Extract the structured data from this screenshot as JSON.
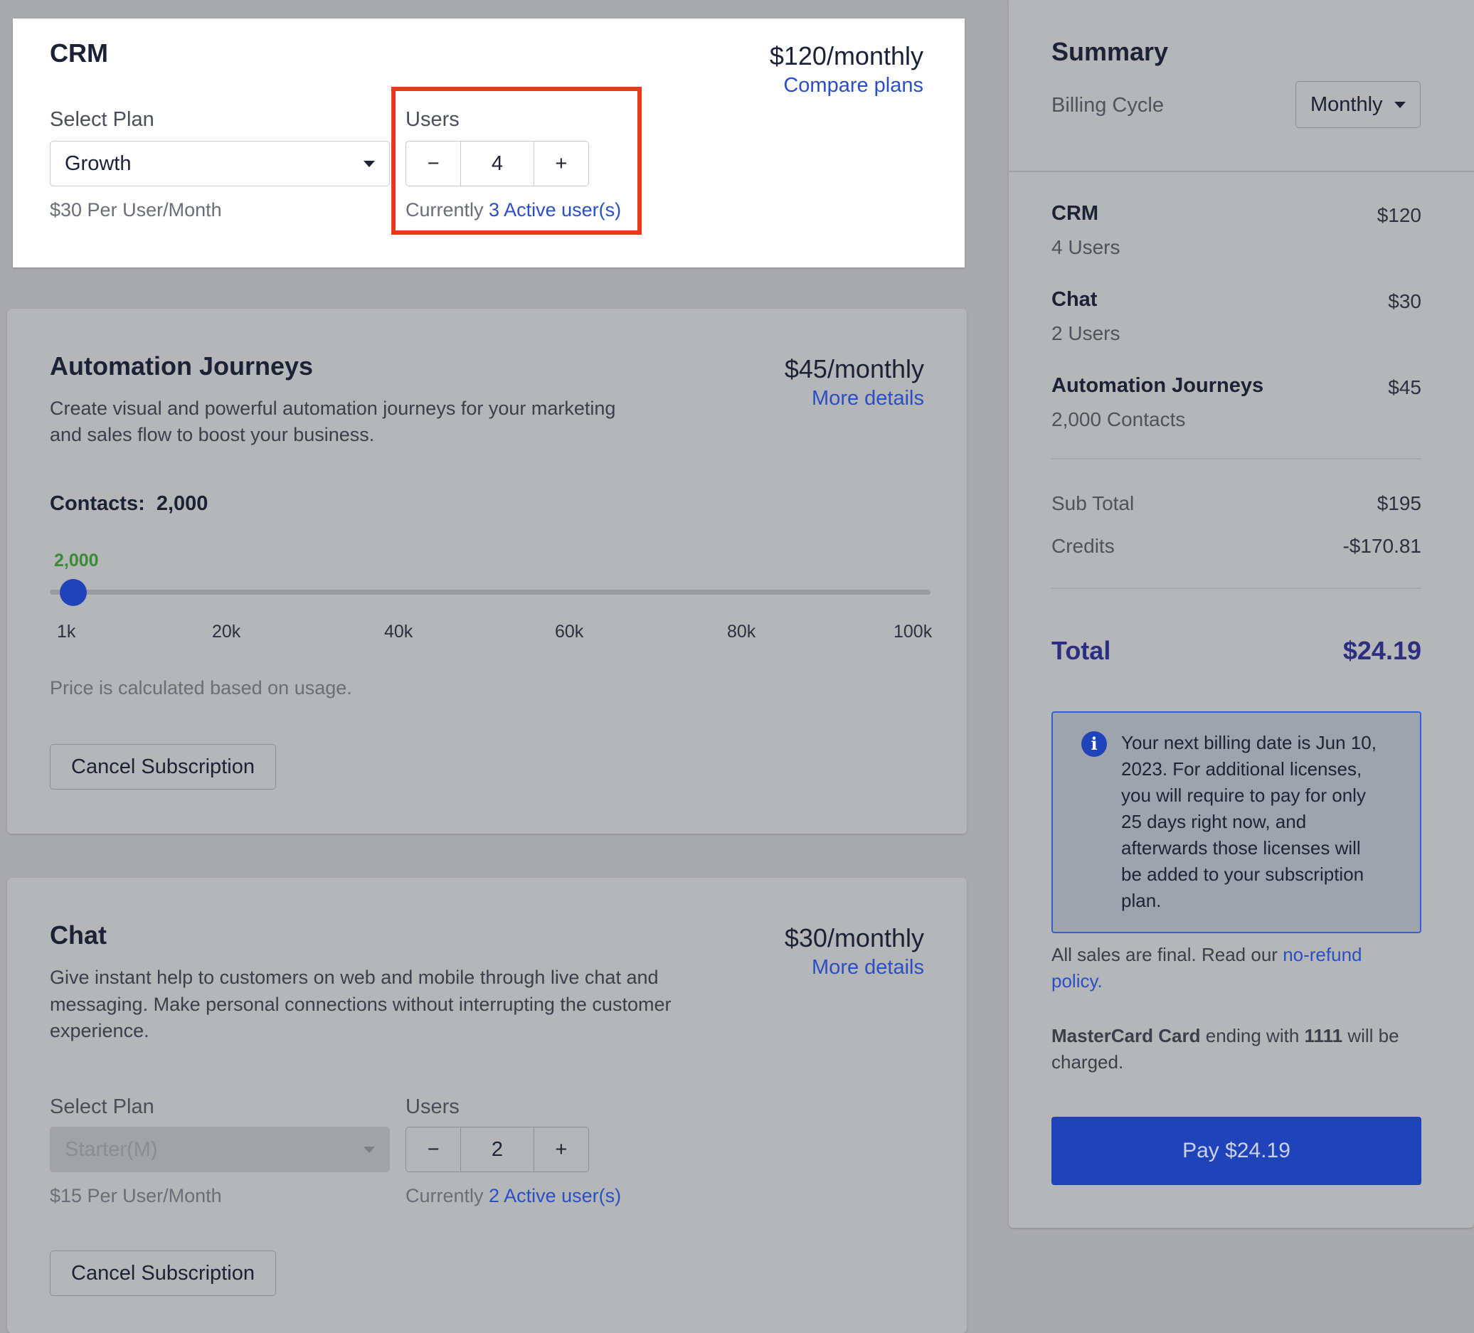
{
  "crm": {
    "title": "CRM",
    "price": "$120/monthly",
    "compare_link": "Compare plans",
    "select_plan_label": "Select Plan",
    "plan_value": "Growth",
    "plan_note": "$30 Per User/Month",
    "users_label": "Users",
    "users_value": "4",
    "minus": "−",
    "plus": "+",
    "currently_prefix": "Currently",
    "active_users_link": "3 Active user(s)"
  },
  "automation": {
    "title": "Automation Journeys",
    "price": "$45/monthly",
    "details_link": "More details",
    "description_line1": "Create visual and powerful automation journeys for your marketing",
    "description_line2": "and sales flow to boost your business.",
    "contacts_label": "Contacts:",
    "contacts_value": "2,000",
    "slider_value_label": "2,000",
    "slider": {
      "min": 1000,
      "max": 100000,
      "value": 2000
    },
    "ticks": [
      "1k",
      "20k",
      "40k",
      "60k",
      "80k",
      "100k"
    ],
    "price_note": "Price is calculated based on usage.",
    "cancel_button": "Cancel Subscription",
    "accent_color": "#3a8a3a"
  },
  "chat": {
    "title": "Chat",
    "price": "$30/monthly",
    "details_link": "More details",
    "description_line1": "Give instant help to customers on web and mobile through live chat and",
    "description_line2": "messaging. Make personal connections without interrupting the customer",
    "description_line3": "experience.",
    "select_plan_label": "Select Plan",
    "plan_value": "Starter(M)",
    "plan_note": "$15 Per User/Month",
    "users_label": "Users",
    "users_value": "2",
    "minus": "−",
    "plus": "+",
    "currently_prefix": "Currently",
    "active_users_link": "2 Active user(s)",
    "cancel_button": "Cancel Subscription"
  },
  "summary": {
    "title": "Summary",
    "billing_cycle_label": "Billing Cycle",
    "billing_cycle_value": "Monthly",
    "items": [
      {
        "name": "CRM",
        "detail": "4 Users",
        "amount": "$120"
      },
      {
        "name": "Chat",
        "detail": "2 Users",
        "amount": "$30"
      },
      {
        "name": "Automation Journeys",
        "detail": "2,000 Contacts",
        "amount": "$45"
      }
    ],
    "subtotal_label": "Sub Total",
    "subtotal_value": "$195",
    "credits_label": "Credits",
    "credits_value": "-$170.81",
    "total_label": "Total",
    "total_value": "$24.19",
    "info_icon": "info-icon",
    "info_lines": [
      "Your next billing date is Jun 10,",
      "2023. For additional licenses,",
      "you will require to pay for only",
      "25 days right now, and",
      "afterwards those licenses will",
      "be added to your subscription",
      "plan."
    ],
    "final_prefix": "All sales are final. Read our",
    "refund_link_1": "no-refund",
    "refund_link_2": "policy.",
    "card_brand": "MasterCard Card",
    "card_mid": "ending with",
    "card_last4": "1111",
    "card_suffix": "will be",
    "card_suffix_2": "charged.",
    "pay_button": "Pay $24.19",
    "accent_color": "#1f44ba",
    "total_color": "#2c2f80"
  },
  "highlight_color": "#e8391d"
}
